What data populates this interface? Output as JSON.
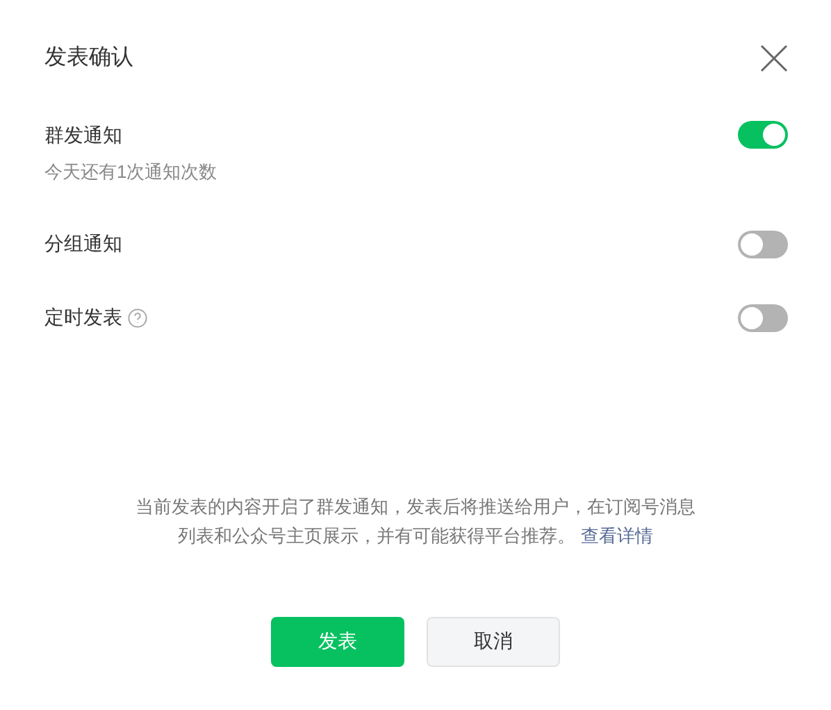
{
  "dialog": {
    "title": "发表确认"
  },
  "options": [
    {
      "label": "群发通知",
      "on": true,
      "help": false,
      "subtitle": "今天还有1次通知次数"
    },
    {
      "label": "分组通知",
      "on": false,
      "help": false
    },
    {
      "label": "定时发表",
      "on": false,
      "help": true
    }
  ],
  "notice": {
    "text": "当前发表的内容开启了群发通知，发表后将推送给用户，在订阅号消息列表和公众号主页展示，并有可能获得平台推荐。",
    "link": "查看详情"
  },
  "buttons": [
    {
      "label": "发表",
      "kind": "primary"
    },
    {
      "label": "取消",
      "kind": "secondary"
    }
  ]
}
